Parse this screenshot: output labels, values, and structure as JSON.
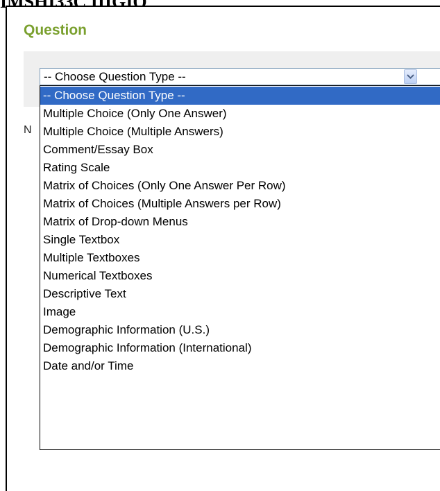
{
  "header": {
    "cut_text": "IMSHI33C IIIGIO"
  },
  "section": {
    "title": "Question",
    "partial_label": "N"
  },
  "question_type_select": {
    "selected_label": "-- Choose Question Type --",
    "options": [
      "-- Choose Question Type --",
      "Multiple Choice (Only One Answer)",
      "Multiple Choice (Multiple Answers)",
      "Comment/Essay Box",
      "Rating Scale",
      "Matrix of Choices (Only One Answer Per Row)",
      "Matrix of Choices (Multiple Answers per Row)",
      "Matrix of Drop-down Menus",
      "Single Textbox",
      "Multiple Textboxes",
      "Numerical Textboxes",
      "Descriptive Text",
      "Image",
      "Demographic Information (U.S.)",
      "Demographic Information (International)",
      "Date and/or Time"
    ],
    "highlighted_index": 0
  },
  "icons": {
    "dropdown_arrow": "chevron-down-icon"
  },
  "colors": {
    "title": "#7aa02e",
    "highlight": "#316ac5",
    "band": "#efefef"
  }
}
